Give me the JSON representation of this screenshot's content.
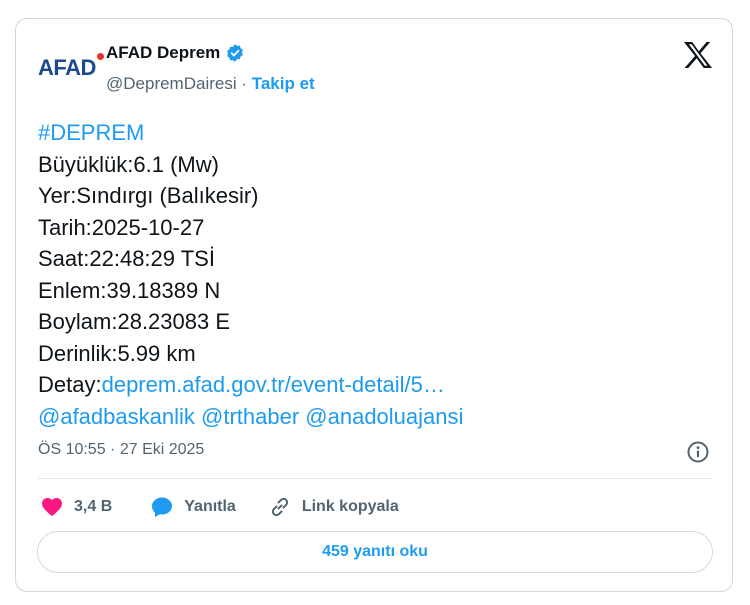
{
  "author": {
    "logo_text": "AFAD",
    "name": "AFAD Deprem",
    "handle": "@DepremDairesi",
    "separator": " · ",
    "follow_label": "Takip et"
  },
  "post": {
    "hashtag": "#DEPREM",
    "magnitude": "Büyüklük:6.1 (Mw)",
    "location": "Yer:Sındırgı (Balıkesir)",
    "date": "Tarih:2025-10-27",
    "time": "Saat:22:48:29 TSİ",
    "latitude": "Enlem:39.18389 N",
    "longitude": "Boylam:28.23083 E",
    "depth": "Derinlik:5.99 km",
    "detail_label": "Detay:",
    "detail_link": "deprem.afad.gov.tr/event-detail/5…",
    "mentions": [
      "@afadbaskanlik",
      "@trthaber",
      "@anadoluajansi"
    ]
  },
  "meta": {
    "timestamp": "ÖS 10:55 · 27 Eki 2025"
  },
  "actions": {
    "like_count": "3,4 B",
    "reply_label": "Yanıtla",
    "copy_link_label": "Link kopyala"
  },
  "read_replies_label": "459 yanıtı oku",
  "colors": {
    "accent": "#1d9bf0",
    "like": "#f91880",
    "text": "#0f1419",
    "muted": "#536471",
    "logo": "#1d4a8f",
    "logo_dot": "#e4322b"
  },
  "icons": {
    "verified": "verified-badge-icon",
    "x": "x-logo-icon",
    "info": "info-icon",
    "like": "heart-icon",
    "reply": "speech-bubble-icon",
    "copy_link": "link-icon"
  }
}
